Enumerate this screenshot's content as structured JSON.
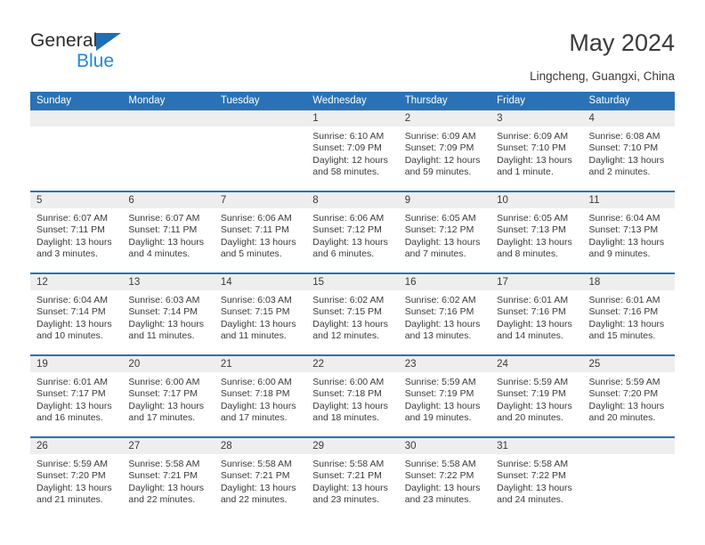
{
  "brand": {
    "name_top": "General",
    "name_bottom": "Blue",
    "triangle_color": "#1f6fb4",
    "blue_color": "#2288d6"
  },
  "header": {
    "title": "May 2024",
    "location": "Lingcheng, Guangxi, China"
  },
  "theme": {
    "header_band": "#2a72b5",
    "day_band": "#eeeeee",
    "text": "#3a3a3a"
  },
  "calendar": {
    "weekday_headers": [
      "Sunday",
      "Monday",
      "Tuesday",
      "Wednesday",
      "Thursday",
      "Friday",
      "Saturday"
    ],
    "weeks": [
      [
        {
          "day": "",
          "empty": true,
          "sunrise": "",
          "sunset": "",
          "daylight": ""
        },
        {
          "day": "",
          "empty": true,
          "sunrise": "",
          "sunset": "",
          "daylight": ""
        },
        {
          "day": "",
          "empty": true,
          "sunrise": "",
          "sunset": "",
          "daylight": ""
        },
        {
          "day": "1",
          "sunrise": "Sunrise: 6:10 AM",
          "sunset": "Sunset: 7:09 PM",
          "daylight": "Daylight: 12 hours and 58 minutes."
        },
        {
          "day": "2",
          "sunrise": "Sunrise: 6:09 AM",
          "sunset": "Sunset: 7:09 PM",
          "daylight": "Daylight: 12 hours and 59 minutes."
        },
        {
          "day": "3",
          "sunrise": "Sunrise: 6:09 AM",
          "sunset": "Sunset: 7:10 PM",
          "daylight": "Daylight: 13 hours and 1 minute."
        },
        {
          "day": "4",
          "sunrise": "Sunrise: 6:08 AM",
          "sunset": "Sunset: 7:10 PM",
          "daylight": "Daylight: 13 hours and 2 minutes."
        }
      ],
      [
        {
          "day": "5",
          "sunrise": "Sunrise: 6:07 AM",
          "sunset": "Sunset: 7:11 PM",
          "daylight": "Daylight: 13 hours and 3 minutes."
        },
        {
          "day": "6",
          "sunrise": "Sunrise: 6:07 AM",
          "sunset": "Sunset: 7:11 PM",
          "daylight": "Daylight: 13 hours and 4 minutes."
        },
        {
          "day": "7",
          "sunrise": "Sunrise: 6:06 AM",
          "sunset": "Sunset: 7:11 PM",
          "daylight": "Daylight: 13 hours and 5 minutes."
        },
        {
          "day": "8",
          "sunrise": "Sunrise: 6:06 AM",
          "sunset": "Sunset: 7:12 PM",
          "daylight": "Daylight: 13 hours and 6 minutes."
        },
        {
          "day": "9",
          "sunrise": "Sunrise: 6:05 AM",
          "sunset": "Sunset: 7:12 PM",
          "daylight": "Daylight: 13 hours and 7 minutes."
        },
        {
          "day": "10",
          "sunrise": "Sunrise: 6:05 AM",
          "sunset": "Sunset: 7:13 PM",
          "daylight": "Daylight: 13 hours and 8 minutes."
        },
        {
          "day": "11",
          "sunrise": "Sunrise: 6:04 AM",
          "sunset": "Sunset: 7:13 PM",
          "daylight": "Daylight: 13 hours and 9 minutes."
        }
      ],
      [
        {
          "day": "12",
          "sunrise": "Sunrise: 6:04 AM",
          "sunset": "Sunset: 7:14 PM",
          "daylight": "Daylight: 13 hours and 10 minutes."
        },
        {
          "day": "13",
          "sunrise": "Sunrise: 6:03 AM",
          "sunset": "Sunset: 7:14 PM",
          "daylight": "Daylight: 13 hours and 11 minutes."
        },
        {
          "day": "14",
          "sunrise": "Sunrise: 6:03 AM",
          "sunset": "Sunset: 7:15 PM",
          "daylight": "Daylight: 13 hours and 11 minutes."
        },
        {
          "day": "15",
          "sunrise": "Sunrise: 6:02 AM",
          "sunset": "Sunset: 7:15 PM",
          "daylight": "Daylight: 13 hours and 12 minutes."
        },
        {
          "day": "16",
          "sunrise": "Sunrise: 6:02 AM",
          "sunset": "Sunset: 7:16 PM",
          "daylight": "Daylight: 13 hours and 13 minutes."
        },
        {
          "day": "17",
          "sunrise": "Sunrise: 6:01 AM",
          "sunset": "Sunset: 7:16 PM",
          "daylight": "Daylight: 13 hours and 14 minutes."
        },
        {
          "day": "18",
          "sunrise": "Sunrise: 6:01 AM",
          "sunset": "Sunset: 7:16 PM",
          "daylight": "Daylight: 13 hours and 15 minutes."
        }
      ],
      [
        {
          "day": "19",
          "sunrise": "Sunrise: 6:01 AM",
          "sunset": "Sunset: 7:17 PM",
          "daylight": "Daylight: 13 hours and 16 minutes."
        },
        {
          "day": "20",
          "sunrise": "Sunrise: 6:00 AM",
          "sunset": "Sunset: 7:17 PM",
          "daylight": "Daylight: 13 hours and 17 minutes."
        },
        {
          "day": "21",
          "sunrise": "Sunrise: 6:00 AM",
          "sunset": "Sunset: 7:18 PM",
          "daylight": "Daylight: 13 hours and 17 minutes."
        },
        {
          "day": "22",
          "sunrise": "Sunrise: 6:00 AM",
          "sunset": "Sunset: 7:18 PM",
          "daylight": "Daylight: 13 hours and 18 minutes."
        },
        {
          "day": "23",
          "sunrise": "Sunrise: 5:59 AM",
          "sunset": "Sunset: 7:19 PM",
          "daylight": "Daylight: 13 hours and 19 minutes."
        },
        {
          "day": "24",
          "sunrise": "Sunrise: 5:59 AM",
          "sunset": "Sunset: 7:19 PM",
          "daylight": "Daylight: 13 hours and 20 minutes."
        },
        {
          "day": "25",
          "sunrise": "Sunrise: 5:59 AM",
          "sunset": "Sunset: 7:20 PM",
          "daylight": "Daylight: 13 hours and 20 minutes."
        }
      ],
      [
        {
          "day": "26",
          "sunrise": "Sunrise: 5:59 AM",
          "sunset": "Sunset: 7:20 PM",
          "daylight": "Daylight: 13 hours and 21 minutes."
        },
        {
          "day": "27",
          "sunrise": "Sunrise: 5:58 AM",
          "sunset": "Sunset: 7:21 PM",
          "daylight": "Daylight: 13 hours and 22 minutes."
        },
        {
          "day": "28",
          "sunrise": "Sunrise: 5:58 AM",
          "sunset": "Sunset: 7:21 PM",
          "daylight": "Daylight: 13 hours and 22 minutes."
        },
        {
          "day": "29",
          "sunrise": "Sunrise: 5:58 AM",
          "sunset": "Sunset: 7:21 PM",
          "daylight": "Daylight: 13 hours and 23 minutes."
        },
        {
          "day": "30",
          "sunrise": "Sunrise: 5:58 AM",
          "sunset": "Sunset: 7:22 PM",
          "daylight": "Daylight: 13 hours and 23 minutes."
        },
        {
          "day": "31",
          "sunrise": "Sunrise: 5:58 AM",
          "sunset": "Sunset: 7:22 PM",
          "daylight": "Daylight: 13 hours and 24 minutes."
        },
        {
          "day": "",
          "empty": true,
          "sunrise": "",
          "sunset": "",
          "daylight": ""
        }
      ]
    ]
  }
}
